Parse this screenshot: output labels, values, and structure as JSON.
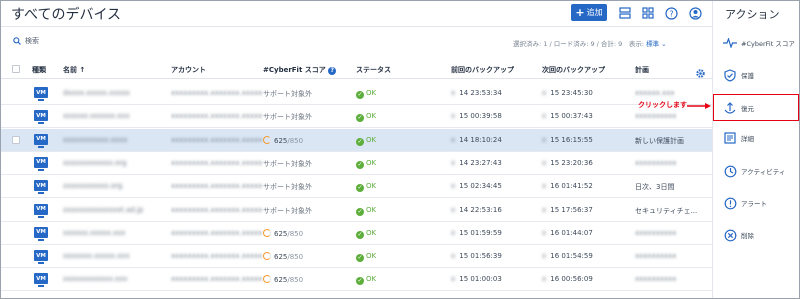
{
  "header": {
    "title": "すべてのデバイス",
    "add_label": "追加"
  },
  "toolbar": {
    "search_label": "検索",
    "summary_prefix": "選択済み: 1 / ロード済み: 9 / 合計: 9　表示:",
    "density_label": "標準"
  },
  "table": {
    "columns": [
      "種類",
      "名前 ↑",
      "アカウント",
      "#CyberFit スコア",
      "ステータス",
      "前回のバックアップ",
      "次回のバックアップ",
      "計画"
    ],
    "rows": [
      {
        "type": "VM",
        "name": "dxxxx.xxxxx.xxxxx",
        "account": "xxxxxxxxx.xxxxxxx.xxxxx",
        "score": "サポート対象外",
        "status": "OK",
        "last": "14 23:53:34",
        "next": "15 23:45:30",
        "plan": "xxxxxx.xxx",
        "selected": false
      },
      {
        "type": "VM",
        "name": "xxxxxx.xxxxxx.xxx",
        "account": "xxxxxxxxx.xxxxxxx.xxxxx",
        "score": "サポート対象外",
        "status": "OK",
        "last": "15 00:39:58",
        "next": "15 00:37:43",
        "plan": "xxxxxxxxxx",
        "selected": false
      },
      {
        "type": "VM",
        "name": "xxxxxxxxxxx.xxxx",
        "account": "xxxxxxxxx.xxxxxxx.xxxxx",
        "score": "625",
        "score_total": "/850",
        "status": "OK",
        "last": "14 18:10:24",
        "next": "15 16:15:55",
        "plan": "新しい保護計画",
        "selected": true
      },
      {
        "type": "VM",
        "name": "xxxxxxxxxxxx.org",
        "account": "xxxxxxxxx.xxxxxxx.xxxxx",
        "score": "サポート対象外",
        "status": "OK",
        "last": "14 23:27:43",
        "next": "15 23:20:36",
        "plan": "xxxxxxxxxx",
        "selected": false
      },
      {
        "type": "VM",
        "name": "xxxxxxxxxxx.org",
        "account": "xxxxxxxxx.xxxxxxx.xxxxx",
        "score": "サポート対象外",
        "status": "OK",
        "last": "15 02:34:45",
        "next": "16 01:41:52",
        "plan": "日次、3日間",
        "selected": false
      },
      {
        "type": "VM",
        "name": "xxxxxxxxxxxxxxt.ad.jp",
        "account": "xxxxxxxxx.xxxxxxx.xxxxx",
        "score": "サポート対象外",
        "status": "OK",
        "last": "14 22:53:16",
        "next": "15 17:56:37",
        "plan": "セキュリティチェ...",
        "selected": false
      },
      {
        "type": "VM",
        "name": "xxxxxx.xxxxx.xxx",
        "account": "xxxxxxxxx.xxxxxxx.xxxxx",
        "score": "625",
        "score_total": "/850",
        "status": "OK",
        "last": "15 01:59:59",
        "next": "16 01:44:07",
        "plan": "xxxxxxxxxx",
        "selected": false
      },
      {
        "type": "VM",
        "name": "xxxxxxx.xxxxx.xxx",
        "account": "xxxxxxxxx.xxxxxxx.xxxxx",
        "score": "625",
        "score_total": "/850",
        "status": "OK",
        "last": "15 01:56:39",
        "next": "16 01:54:59",
        "plan": "xxxxxxxxxx",
        "selected": false
      },
      {
        "type": "VM",
        "name": "xxxxxxxxxxxx.xxx",
        "account": "xxxxxxxxx.xxxxxxx.xxxxx",
        "score": "625",
        "score_total": "/850",
        "status": "OK",
        "last": "15 01:00:03",
        "next": "16 00:56:09",
        "plan": "xxxxxxxxxx",
        "selected": false
      }
    ]
  },
  "panel": {
    "title": "アクション",
    "items": [
      {
        "label": "#CyberFit スコア",
        "icon": "pulse-icon"
      },
      {
        "label": "保護",
        "icon": "shield-icon"
      },
      {
        "label": "復元",
        "icon": "restore-icon"
      },
      {
        "label": "詳細",
        "icon": "details-icon"
      },
      {
        "label": "アクティビティ",
        "icon": "clock-icon"
      },
      {
        "label": "アラート",
        "icon": "alert-icon"
      },
      {
        "label": "削除",
        "icon": "delete-icon"
      }
    ]
  },
  "annotation": {
    "callout": "クリックします",
    "color": "#e60012"
  },
  "colors": {
    "accent": "#2668c5",
    "ok": "#5dae3b",
    "score": "#f29b30",
    "selected_row": "#dbe6f4"
  }
}
